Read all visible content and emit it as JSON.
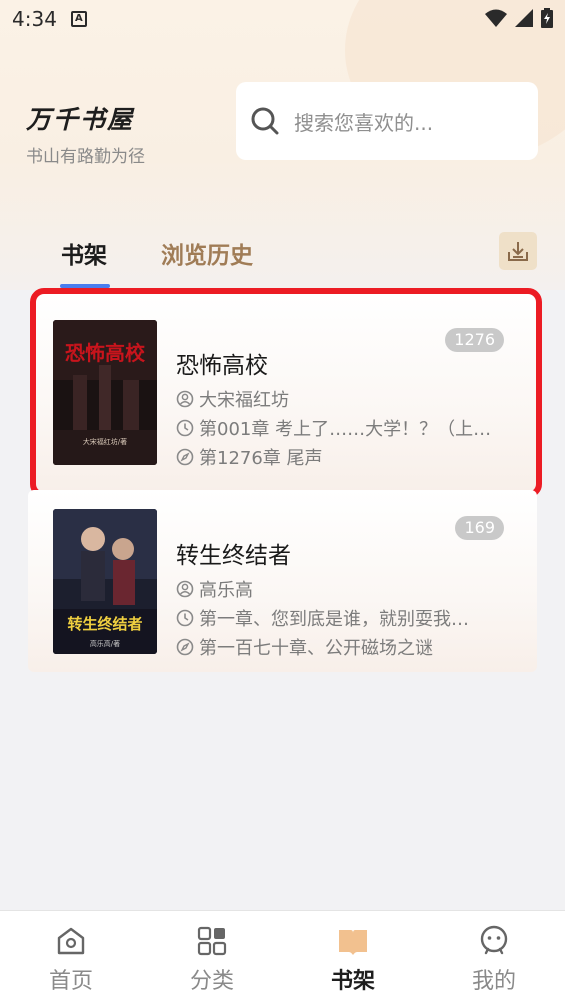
{
  "status_bar": {
    "time": "4:34",
    "sim_label": "A"
  },
  "header": {
    "app_title": "万千书屋",
    "slogan": "书山有路勤为径",
    "search_placeholder": "搜索您喜欢的..."
  },
  "tabs": {
    "shelf_label": "书架",
    "history_label": "浏览历史"
  },
  "books": [
    {
      "title": "恐怖高校",
      "chapter_count": "1276",
      "author": "大宋福红坊",
      "last_read": "第001章  考上了……大学！？（上…",
      "latest": "第1276章  尾声",
      "cover_text": "恐怖高校",
      "cover_author": "大宋福红坊/著"
    },
    {
      "title": "转生终结者",
      "chapter_count": "169",
      "author": "高乐高",
      "last_read": "第一章、您到底是谁，就别耍我…",
      "latest": "第一百七十章、公开磁场之谜",
      "cover_text": "转生终结者",
      "cover_author": "高乐高/著"
    }
  ],
  "bottom_nav": {
    "items": [
      {
        "label": "首页",
        "icon": "home-icon"
      },
      {
        "label": "分类",
        "icon": "category-icon"
      },
      {
        "label": "书架",
        "icon": "bookshelf-icon",
        "active": true
      },
      {
        "label": "我的",
        "icon": "profile-icon"
      }
    ]
  },
  "colors": {
    "accent_blue": "#4a7ef0",
    "history_tab": "#a07c56",
    "highlight_border": "#ec1c24",
    "active_nav_icon": "#f2c18f"
  }
}
